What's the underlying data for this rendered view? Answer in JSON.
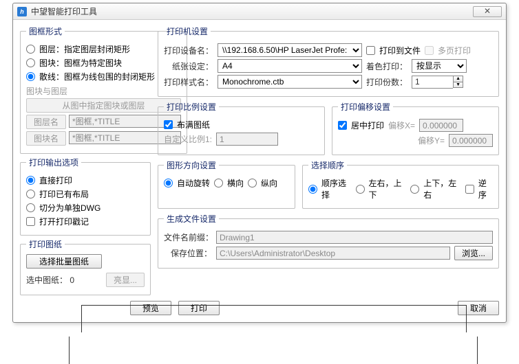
{
  "title": "中望智能打印工具",
  "close": "✕",
  "frame": {
    "legend": "图框形式",
    "opt_layer": "图层：指定图层封闭矩形",
    "opt_block": "图块：图框为特定图块",
    "opt_scatter": "散线：图框为线包围的封闭矩形",
    "sub_legend": "图块与图层",
    "btn_pick": "从图中指定图块或图层",
    "btn_layer": "图层名",
    "btn_block": "图块名",
    "val_layer": "*图框,*TITLE",
    "val_block": "*图框,*TITLE"
  },
  "output": {
    "legend": "打印输出选项",
    "opt_direct": "直接打印",
    "opt_existing": "打印已有布局",
    "opt_split": "切分为单独DWG",
    "chk_stamp": "打开打印戳记"
  },
  "paper": {
    "legend": "打印图纸",
    "btn_select": "选择批量图纸",
    "selected_label": "选中图纸：",
    "selected_count": "0",
    "btn_highlight": "亮显..."
  },
  "printer": {
    "legend": "打印机设置",
    "device_label": "打印设备名：",
    "device_value": "\\\\192.168.6.50\\HP LaserJet Profe:",
    "to_file": "打印到文件",
    "multi_page": "多页打印",
    "paper_label": "纸张设定：",
    "paper_value": "A4",
    "color_label": "着色打印：",
    "color_value": "按显示",
    "style_label": "打印样式名：",
    "style_value": "Monochrome.ctb",
    "copies_label": "打印份数：",
    "copies_value": "1"
  },
  "scale": {
    "legend": "打印比例设置",
    "fit": "布满图纸",
    "custom_label": "自定义比例1:",
    "custom_value": "1"
  },
  "offset": {
    "legend": "打印偏移设置",
    "center": "居中打印",
    "x_label": "偏移X=",
    "x_value": "0.000000",
    "y_label": "偏移Y=",
    "y_value": "0.000000"
  },
  "orient": {
    "legend": "图形方向设置",
    "auto": "自动旋转",
    "landscape": "横向",
    "portrait": "纵向"
  },
  "order": {
    "legend": "选择顺序",
    "pick": "顺序选择",
    "lr_tb": "左右，上下",
    "tb_lr": "上下，左右",
    "reverse": "逆序"
  },
  "gen": {
    "legend": "生成文件设置",
    "prefix_label": "文件名前缀：",
    "prefix_value": "Drawing1",
    "path_label": "保存位置：",
    "path_value": "C:\\Users\\Administrator\\Desktop",
    "browse": "浏览..."
  },
  "actions": {
    "preview": "预览",
    "print": "打印",
    "cancel": "取消"
  }
}
